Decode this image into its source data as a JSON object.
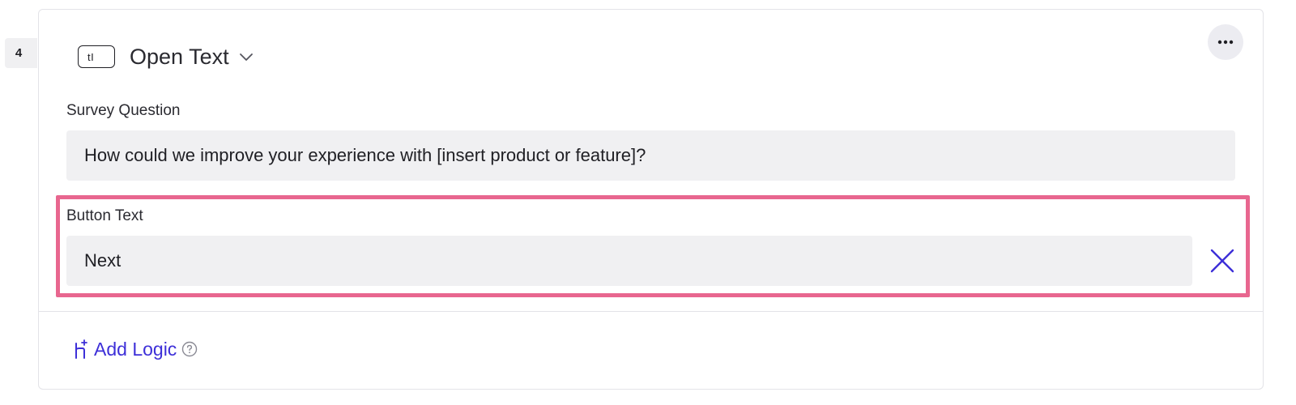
{
  "question": {
    "number": "4",
    "type_icon_text": "tI",
    "type_label": "Open Text",
    "type_icon": "text-input-icon",
    "more_icon": "more-horizontal-icon"
  },
  "survey_question": {
    "label": "Survey Question",
    "value": "How could we improve your experience with [insert product or feature]?"
  },
  "button_text": {
    "label": "Button Text",
    "value": "Next",
    "remove_icon": "close-icon"
  },
  "add_logic": {
    "label": "Add Logic",
    "icon": "branch-plus-icon",
    "help_icon": "help-circle-icon"
  },
  "colors": {
    "accent": "#3d2fd8",
    "highlight": "#e8668f",
    "field_bg": "#f0f0f2"
  }
}
